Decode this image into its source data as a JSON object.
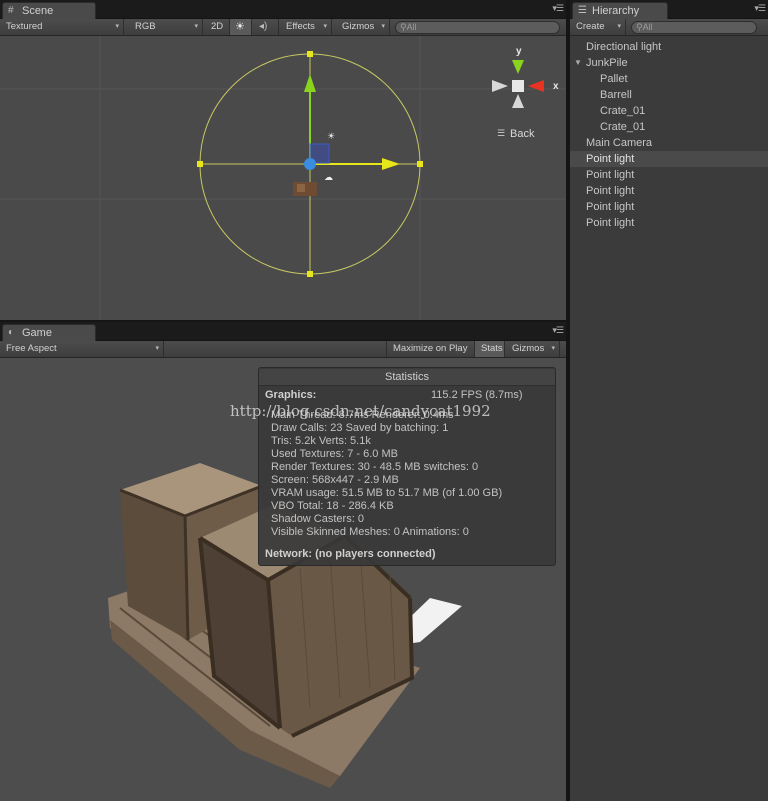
{
  "scene": {
    "tab_label": "Scene",
    "toolbar": {
      "render_mode": "Textured",
      "color_mode": "RGB",
      "mode_2d": "2D",
      "effects_label": "Effects",
      "gizmos_label": "Gizmos",
      "search_placeholder": "All"
    },
    "gizmo": {
      "axis_y": "y",
      "axis_x": "x",
      "view_label": "Back"
    }
  },
  "hierarchy": {
    "tab_label": "Hierarchy",
    "create_label": "Create",
    "search_placeholder": "All",
    "items": [
      {
        "label": "Directional light",
        "depth": 0,
        "selected": false
      },
      {
        "label": "JunkPile",
        "depth": 0,
        "selected": false,
        "expanded": true
      },
      {
        "label": "Pallet",
        "depth": 1,
        "selected": false
      },
      {
        "label": "Barrell",
        "depth": 1,
        "selected": false
      },
      {
        "label": "Crate_01",
        "depth": 1,
        "selected": false
      },
      {
        "label": "Crate_01",
        "depth": 1,
        "selected": false
      },
      {
        "label": "Main Camera",
        "depth": 0,
        "selected": false
      },
      {
        "label": "Point light",
        "depth": 0,
        "selected": true
      },
      {
        "label": "Point light",
        "depth": 0,
        "selected": false
      },
      {
        "label": "Point light",
        "depth": 0,
        "selected": false
      },
      {
        "label": "Point light",
        "depth": 0,
        "selected": false
      },
      {
        "label": "Point light",
        "depth": 0,
        "selected": false
      }
    ]
  },
  "game": {
    "tab_label": "Game",
    "aspect_label": "Free Aspect",
    "maximize_label": "Maximize on Play",
    "stats_label": "Stats",
    "gizmos_label": "Gizmos"
  },
  "statistics": {
    "title": "Statistics",
    "graphics_label": "Graphics:",
    "fps": "115.2 FPS (8.7ms)",
    "main_thread": "Main Thread: 8.7ms  Renderer: 0.4ms",
    "draw_calls": "Draw Calls: 23    Saved by batching: 1",
    "tris": "Tris: 5.2k   Verts: 5.1k",
    "used_textures": "Used Textures: 7 - 6.0 MB",
    "render_textures": "Render Textures: 30 - 48.5 MB   switches: 0",
    "screen": "Screen: 568x447 - 2.9 MB",
    "vram": "VRAM usage: 51.5 MB to 51.7 MB (of 1.00 GB)",
    "vbo": "VBO Total: 18 - 286.4 KB",
    "shadow_casters": "Shadow Casters: 0",
    "skinned": "Visible Skinned Meshes: 0       Animations: 0",
    "network": "Network: (no players connected)"
  },
  "watermark": "http://blog.csdn.net/candycat1992",
  "colors": {
    "panel_bg": "#3b3b3b",
    "scene_bg": "#4a4a4a",
    "axis_y": "#8ad41e",
    "axis_x": "#e6e619",
    "axis_x_gizmo": "#e83222",
    "center": "#3b8de0",
    "light_circle": "#c8c864"
  }
}
